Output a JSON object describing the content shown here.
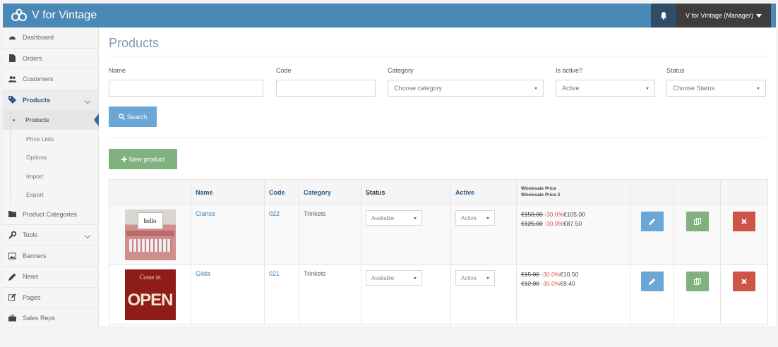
{
  "header": {
    "brand": "V for Vintage",
    "user": "V for Vintage (Manager)"
  },
  "sidebar": {
    "items": [
      {
        "label": "Dashboard",
        "icon": "dashboard-icon"
      },
      {
        "label": "Orders",
        "icon": "file-icon"
      },
      {
        "label": "Customers",
        "icon": "users-icon"
      },
      {
        "label": "Products",
        "icon": "tag-icon"
      }
    ],
    "subitems": [
      {
        "label": "Products"
      },
      {
        "label": "Price Lists"
      },
      {
        "label": "Options"
      },
      {
        "label": "Import"
      },
      {
        "label": "Export"
      }
    ],
    "items2": [
      {
        "label": "Product Categories",
        "icon": "folder-icon"
      },
      {
        "label": "Tools",
        "icon": "wrench-icon"
      },
      {
        "label": "Banners",
        "icon": "image-icon"
      },
      {
        "label": "News",
        "icon": "pencil-icon"
      },
      {
        "label": "Pages",
        "icon": "edit-icon"
      },
      {
        "label": "Sales Reps",
        "icon": "briefcase-icon"
      }
    ]
  },
  "page": {
    "title": "Products"
  },
  "filters": {
    "name_label": "Name",
    "name_value": "",
    "code_label": "Code",
    "code_value": "",
    "category_label": "Category",
    "category_value": "Choose category",
    "active_label": "Is active?",
    "active_value": "Active",
    "status_label": "Status",
    "status_value": "Choose Status"
  },
  "buttons": {
    "search": "Search",
    "new_product": "New product"
  },
  "table": {
    "headers": {
      "name": "Name",
      "code": "Code",
      "category": "Category",
      "status": "Status",
      "active": "Active",
      "price1": "Wholesale Price",
      "price2": "Wholesale Price 2"
    },
    "rows": [
      {
        "name": "Clarice",
        "code": "022",
        "category": "Trinkets",
        "status": "Available",
        "active": "Active",
        "p1_old": "€150.00",
        "p1_disc": "-30.0%",
        "p1_new": "€105.00",
        "p2_old": "€125.00",
        "p2_disc": "-30.0%",
        "p2_new": "€87.50",
        "thumb_text": "hello"
      },
      {
        "name": "Gilda",
        "code": "021",
        "category": "Trinkets",
        "status": "Available",
        "active": "Active",
        "p1_old": "€15.00",
        "p1_disc": "-30.0%",
        "p1_new": "€10.50",
        "p2_old": "€12.00",
        "p2_disc": "-30.0%",
        "p2_new": "€8.40",
        "thumb_script": "Come in",
        "thumb_text": "OPEN"
      }
    ]
  }
}
